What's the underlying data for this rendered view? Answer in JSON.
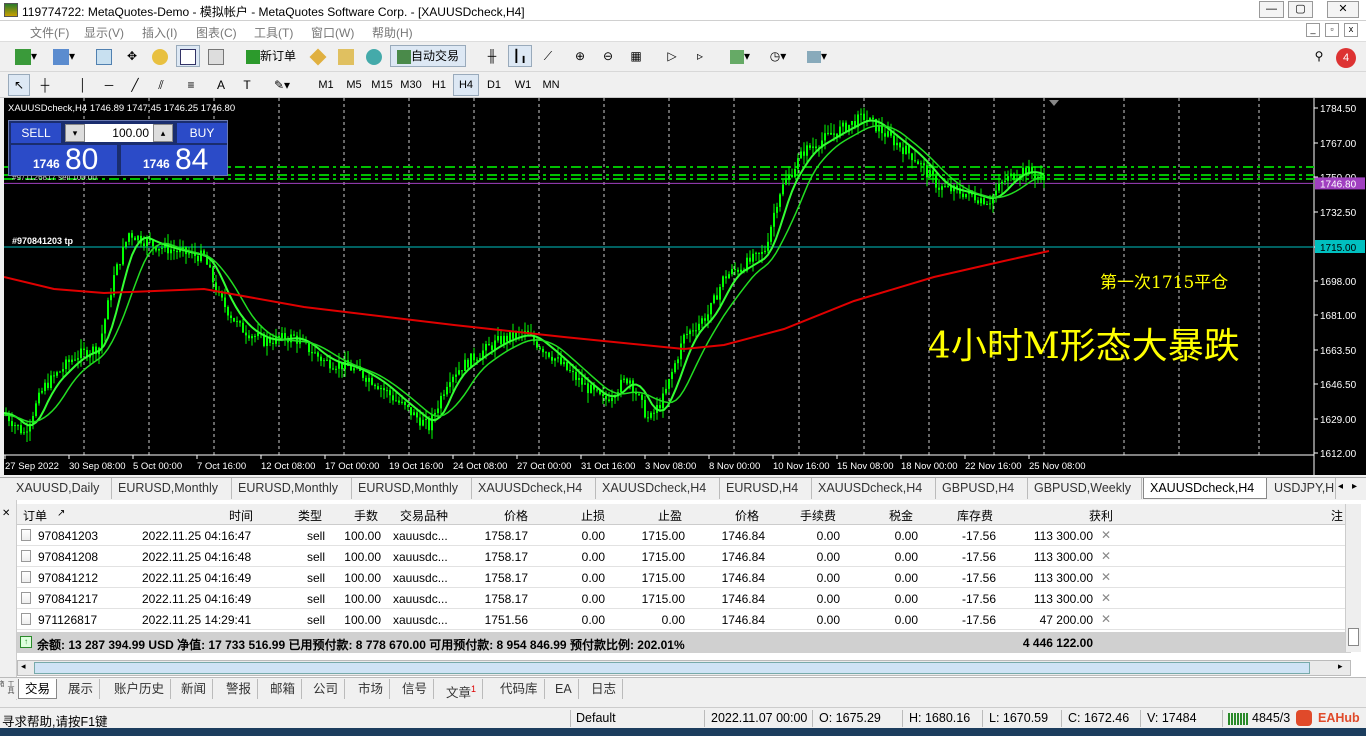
{
  "window": {
    "title": "119774722: MetaQuotes-Demo - 模拟帐户 - MetaQuotes Software Corp. - [XAUUSDcheck,H4]"
  },
  "menu": [
    "文件(F)",
    "显示(V)",
    "插入(I)",
    "图表(C)",
    "工具(T)",
    "窗口(W)",
    "帮助(H)"
  ],
  "toolbar": {
    "new_order": "新订单",
    "autotrade": "自动交易",
    "notify_count": "4"
  },
  "timeframes": [
    "M1",
    "M5",
    "M15",
    "M30",
    "H1",
    "H4",
    "D1",
    "W1",
    "MN"
  ],
  "active_timeframe": "H4",
  "chart": {
    "info": "XAUUSDcheck,H4  1746.89 1747.45 1746.25 1746.80",
    "sell_label": "SELL",
    "buy_label": "BUY",
    "lot": "100.00",
    "sell_prefix": "1746",
    "sell_big": "80",
    "buy_prefix": "1746",
    "buy_big": "84",
    "order_line_label": "#971126817 sell 100.00",
    "tp_label": "#970841203 tp",
    "price_labels": [
      "1784.50",
      "1767.00",
      "1750.00",
      "1732.50",
      "1715.00",
      "1698.00",
      "1681.00",
      "1663.50",
      "1646.50",
      "1629.00",
      "1612.00"
    ],
    "current_price": "1746.80",
    "tp_price": "1715.00",
    "time_labels": [
      "27 Sep 2022",
      "30 Sep 08:00",
      "5 Oct 00:00",
      "7 Oct 16:00",
      "12 Oct 08:00",
      "17 Oct 00:00",
      "19 Oct 16:00",
      "24 Oct 08:00",
      "27 Oct 00:00",
      "31 Oct 16:00",
      "3 Nov 08:00",
      "8 Nov 00:00",
      "10 Nov 16:00",
      "15 Nov 08:00",
      "18 Nov 00:00",
      "22 Nov 16:00",
      "25 Nov 08:00"
    ],
    "annotation1": "第一次1715平仓",
    "annotation2": "4小时M形态大暴跌",
    "colors": {
      "bg": "#000000",
      "candle": "#00ff00",
      "ma_slow": "#e00000",
      "ma_fast": "#33ff33",
      "annotation": "#ffff00",
      "tp_line": "#00c0c0",
      "order_line": "#00c000"
    }
  },
  "chart_tabs": [
    "XAUUSD,Daily",
    "EURUSD,Monthly",
    "EURUSD,Monthly",
    "EURUSD,Monthly",
    "XAUUSDcheck,H4",
    "XAUUSDcheck,H4",
    "EURUSD,H4",
    "XAUUSDcheck,H4",
    "GBPUSD,H4",
    "GBPUSD,Weekly",
    "XAUUSDcheck,H4",
    "USDJPY,H"
  ],
  "active_chart_tab": 10,
  "terminal": {
    "headers": [
      "订单",
      "时间",
      "类型",
      "手数",
      "交易品种",
      "价格",
      "止损",
      "止盈",
      "价格",
      "手续费",
      "税金",
      "库存费",
      "获利",
      "注"
    ],
    "rows": [
      [
        "970841203",
        "2022.11.25 04:16:47",
        "sell",
        "100.00",
        "xauusdc...",
        "1758.17",
        "0.00",
        "1715.00",
        "1746.84",
        "0.00",
        "0.00",
        "-17.56",
        "113 300.00"
      ],
      [
        "970841208",
        "2022.11.25 04:16:48",
        "sell",
        "100.00",
        "xauusdc...",
        "1758.17",
        "0.00",
        "1715.00",
        "1746.84",
        "0.00",
        "0.00",
        "-17.56",
        "113 300.00"
      ],
      [
        "970841212",
        "2022.11.25 04:16:49",
        "sell",
        "100.00",
        "xauusdc...",
        "1758.17",
        "0.00",
        "1715.00",
        "1746.84",
        "0.00",
        "0.00",
        "-17.56",
        "113 300.00"
      ],
      [
        "970841217",
        "2022.11.25 04:16:49",
        "sell",
        "100.00",
        "xauusdc...",
        "1758.17",
        "0.00",
        "1715.00",
        "1746.84",
        "0.00",
        "0.00",
        "-17.56",
        "113 300.00"
      ],
      [
        "971126817",
        "2022.11.25 14:29:41",
        "sell",
        "100.00",
        "xauusdc...",
        "1751.56",
        "0.00",
        "0.00",
        "1746.84",
        "0.00",
        "0.00",
        "-17.56",
        "47 200.00"
      ]
    ],
    "summary": "余额: 13 287 394.99 USD  净值: 17 733 516.99  已用预付款: 8 778 670.00  可用预付款: 8 954 846.99  预付款比例: 202.01%",
    "summary_profit": "4 446 122.00"
  },
  "bottom_tabs": [
    "交易",
    "展示",
    "账户历史",
    "新闻",
    "警报",
    "邮箱",
    "公司",
    "市场",
    "信号",
    "文章",
    "代码库",
    "EA",
    "日志"
  ],
  "article_badge": "1",
  "status": {
    "help": "寻求帮助,请按F1键",
    "profile": "Default",
    "time": "2022.11.07 00:00",
    "open": "O: 1675.29",
    "high": "H: 1680.16",
    "low": "L: 1670.59",
    "close": "C: 1672.46",
    "volume": "V: 17484",
    "traffic": "4845/3",
    "brand": "EAHub"
  }
}
